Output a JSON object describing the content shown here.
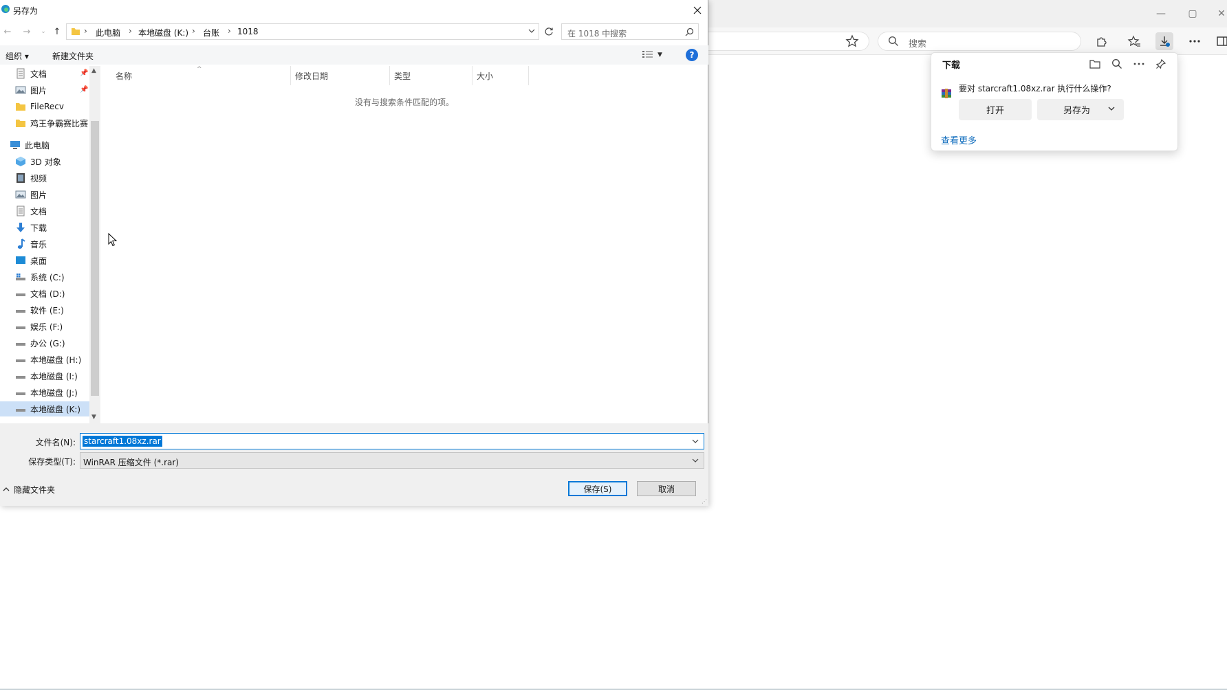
{
  "browser": {
    "search_placeholder": "搜索",
    "window_controls": [
      "minimize-icon",
      "maximize-icon",
      "close-icon"
    ],
    "toolbar_icons": [
      "favorite-star-icon",
      "extensions-icon",
      "favorites-icon",
      "downloads-icon",
      "more-icon",
      "sidebar-icon"
    ]
  },
  "downloads": {
    "title": "下载",
    "question": "要对 starcraft1.08xz.rar 执行什么操作?",
    "open_label": "打开",
    "saveas_label": "另存为",
    "see_more_label": "查看更多",
    "accent": "#0f6cbd"
  },
  "dialog": {
    "title": "另存为",
    "breadcrumbs": [
      "此电脑",
      "本地磁盘 (K:)",
      "台账",
      "1018"
    ],
    "search_placeholder": "在 1018 中搜索",
    "organize_label": "组织 ▾",
    "new_folder_label": "新建文件夹",
    "help_label": "?",
    "nav_items": [
      {
        "label": "文档",
        "icon": "documents-icon",
        "pinned": true
      },
      {
        "label": "图片",
        "icon": "pictures-icon",
        "pinned": true
      },
      {
        "label": "FileRecv",
        "icon": "folder-icon"
      },
      {
        "label": "鸡王争霸赛比赛",
        "icon": "folder-icon"
      },
      {
        "label": "此电脑",
        "icon": "computer-icon"
      },
      {
        "label": "3D 对象",
        "icon": "3d-objects-icon"
      },
      {
        "label": "视频",
        "icon": "videos-icon"
      },
      {
        "label": "图片",
        "icon": "pictures-icon"
      },
      {
        "label": "文档",
        "icon": "documents-icon"
      },
      {
        "label": "下载",
        "icon": "downloads-icon"
      },
      {
        "label": "音乐",
        "icon": "music-icon"
      },
      {
        "label": "桌面",
        "icon": "desktop-icon"
      },
      {
        "label": "系统 (C:)",
        "icon": "system-drive-icon"
      },
      {
        "label": "文档 (D:)",
        "icon": "drive-icon"
      },
      {
        "label": "软件 (E:)",
        "icon": "drive-icon"
      },
      {
        "label": "娱乐 (F:)",
        "icon": "drive-icon"
      },
      {
        "label": "办公 (G:)",
        "icon": "drive-icon"
      },
      {
        "label": "本地磁盘 (H:)",
        "icon": "drive-icon"
      },
      {
        "label": "本地磁盘 (I:)",
        "icon": "drive-icon"
      },
      {
        "label": "本地磁盘 (J:)",
        "icon": "drive-icon"
      },
      {
        "label": "本地磁盘 (K:)",
        "icon": "drive-icon",
        "selected": true
      }
    ],
    "columns": [
      "名称",
      "修改日期",
      "类型",
      "大小"
    ],
    "empty_message": "没有与搜索条件匹配的项。",
    "filename_label": "文件名(N):",
    "filename_value": "starcraft1.08xz.rar",
    "filetype_label": "保存类型(T):",
    "filetype_value": "WinRAR 压缩文件 (*.rar)",
    "hide_folders_label": "隐藏文件夹",
    "save_label": "保存(S)",
    "cancel_label": "取消"
  }
}
